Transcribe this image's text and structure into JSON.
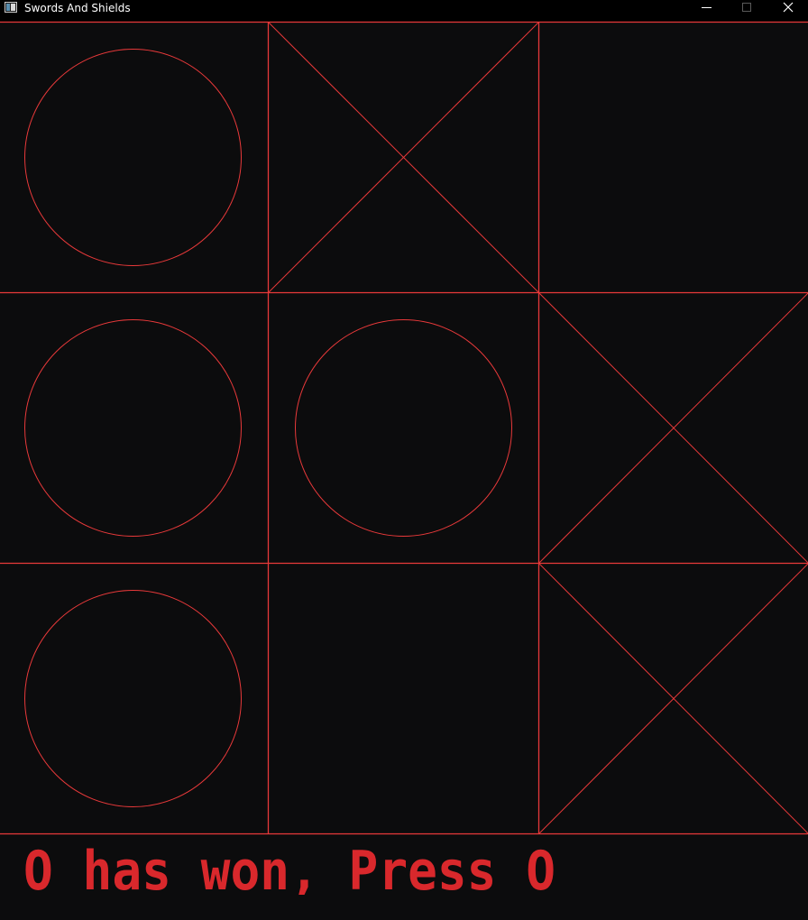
{
  "window": {
    "title": "Swords And Shields",
    "buttons": {
      "minimize": "minimize-icon",
      "maximize": "maximize-icon",
      "close": "close-icon"
    }
  },
  "theme": {
    "background": "#0c0c0d",
    "line_color": "#e8393a",
    "text_color": "#d9282c",
    "titlebar": "#000000"
  },
  "board": {
    "rows": 3,
    "cols": 3,
    "cells": [
      [
        "O",
        "X",
        ""
      ],
      [
        "O",
        "O",
        "X"
      ],
      [
        "O",
        "",
        "X"
      ]
    ]
  },
  "status": {
    "message": "O has won, Press O"
  }
}
